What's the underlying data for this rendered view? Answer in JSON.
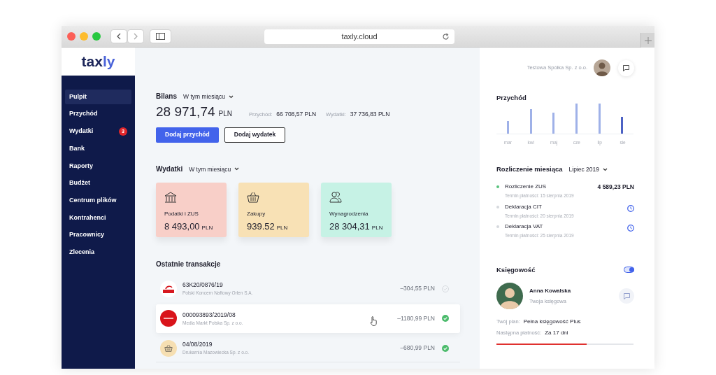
{
  "browser": {
    "url": "taxly.cloud"
  },
  "logo": {
    "text": "tax",
    "accent": "ly"
  },
  "sidebar": {
    "items": [
      {
        "label": "Pulpit",
        "selected": true
      },
      {
        "label": "Przychód",
        "selected": false
      },
      {
        "label": "Wydatki",
        "selected": false,
        "badge": "3"
      },
      {
        "label": "Bank",
        "selected": false
      },
      {
        "label": "Raporty",
        "selected": false
      },
      {
        "label": "Budżet",
        "selected": false
      },
      {
        "label": "Centrum plików",
        "selected": false
      },
      {
        "label": "Kontrahenci",
        "selected": false
      },
      {
        "label": "Pracownicy",
        "selected": false
      },
      {
        "label": "Zlecenia",
        "selected": false
      }
    ]
  },
  "balance": {
    "title": "Bilans",
    "period": "W tym miesiącu",
    "amount": "28 971,74",
    "currency": "PLN",
    "income_label": "Przychód:",
    "income": "66 708,57 PLN",
    "expense_label": "Wydatki:",
    "expense": "37 736,83 PLN"
  },
  "buttons": [
    {
      "label": "Dodaj przychód",
      "kind": "primary"
    },
    {
      "label": "Dodaj wydatek",
      "kind": "outline"
    }
  ],
  "expenses": {
    "title": "Wydatki",
    "period": "W tym miesiącu",
    "cards": [
      {
        "kind": "bank",
        "label": "Podatki i ZUS",
        "amount": "8 493,00",
        "currency": "PLN",
        "color": "#f8cfc8"
      },
      {
        "kind": "basket",
        "label": "Zakupy",
        "amount": "939.52",
        "currency": "PLN",
        "color": "#f8e1b5"
      },
      {
        "kind": "people",
        "label": "Wynagrodzenia",
        "amount": "28 304,31",
        "currency": "PLN",
        "color": "#c6f2e5"
      }
    ]
  },
  "transactions": {
    "title": "Ostatnie transakcje",
    "rows": [
      {
        "kind": "fuel",
        "number": "63K20/0876/19",
        "company": "Polski Koncern Naftowy Orlen S.A.",
        "amount": "–304,55 PLN",
        "paid": false,
        "highlighted": false
      },
      {
        "kind": "store",
        "number": "000093893/2019/08",
        "company": "Media Markt Polska Sp. z o.o.",
        "amount": "–1180,99 PLN",
        "paid": true,
        "highlighted": true
      },
      {
        "kind": "basket",
        "number": "04/08/2019",
        "company": "Drukarnia Mazowiecka Sp. z o.o.",
        "amount": "–680,99 PLN",
        "paid": true,
        "highlighted": false
      }
    ]
  },
  "company": "Testowa Spółka Sp. z o.o.",
  "revenue": {
    "title": "Przychód",
    "months": [
      {
        "label": "mar",
        "selected": false
      },
      {
        "label": "kwi",
        "selected": false
      },
      {
        "label": "maj",
        "selected": false
      },
      {
        "label": "cze",
        "selected": false
      },
      {
        "label": "lip",
        "selected": false
      },
      {
        "label": "sie",
        "selected": true
      }
    ]
  },
  "settlement": {
    "title": "Rozliczenie miesiąca",
    "period": "Lipiec 2019",
    "items": [
      {
        "title": "Rozliczenie ZUS",
        "due": "Termin płatności: 15 sierpnia 2019",
        "done": true,
        "amount": "4 589,23 PLN"
      },
      {
        "title": "Deklaracja CIT",
        "due": "Termin płatności: 20 sierpnia 2019",
        "done": false
      },
      {
        "title": "Deklaracja VAT",
        "due": "Termin płatności: 25 sierpnia 2019",
        "done": false
      }
    ]
  },
  "accounting": {
    "title": "Księgowość",
    "on": true,
    "name": "Anna Kowalska",
    "role": "Twoja księgowa",
    "plan_label": "Twój plan:",
    "plan": "Pełna księgowość Plus",
    "next_label": "Następna płatność:",
    "next": "Za 17 dni",
    "level": 0.66
  }
}
